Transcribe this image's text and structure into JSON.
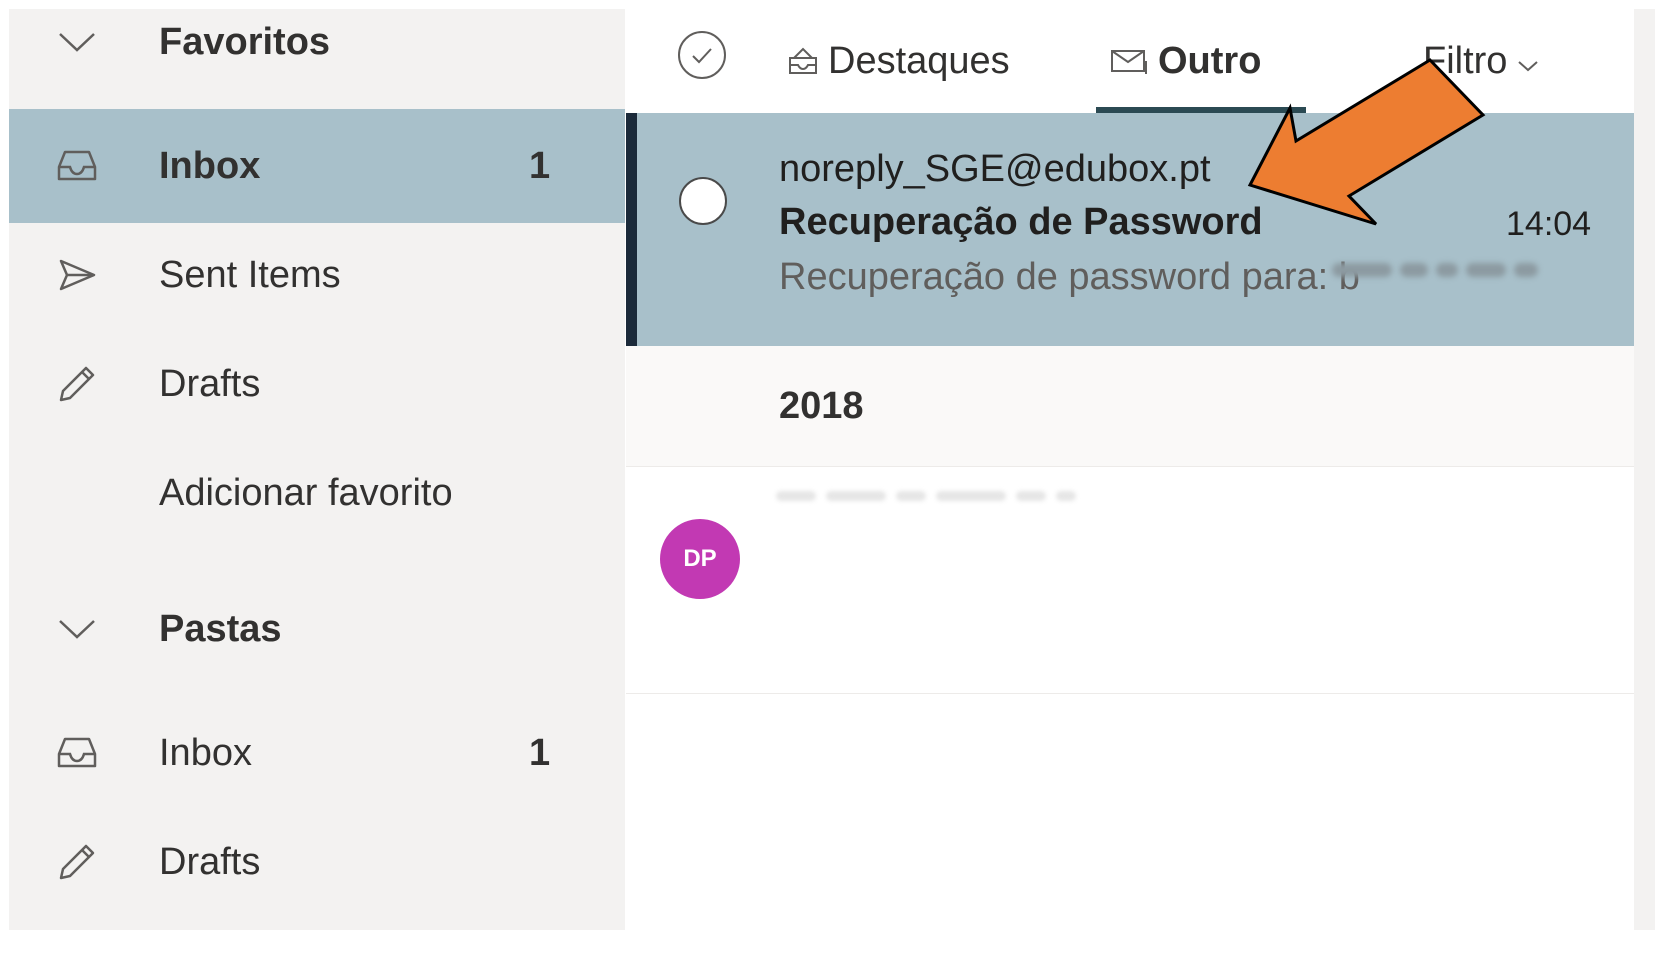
{
  "sidebar": {
    "favorites_header": {
      "label": "Favoritos",
      "icon": "chevron-down-icon"
    },
    "favorites": [
      {
        "label": "Inbox",
        "count": "1",
        "icon": "inbox-icon",
        "selected": true
      },
      {
        "label": "Sent Items",
        "count": "",
        "icon": "send-icon",
        "selected": false
      },
      {
        "label": "Drafts",
        "count": "",
        "icon": "pencil-icon",
        "selected": false
      }
    ],
    "add_favorite_label": "Adicionar favorito",
    "folders_header": {
      "label": "Pastas",
      "icon": "chevron-down-icon"
    },
    "folders": [
      {
        "label": "Inbox",
        "count": "1",
        "icon": "inbox-icon"
      },
      {
        "label": "Drafts",
        "count": "",
        "icon": "pencil-icon"
      }
    ]
  },
  "tabs": {
    "select_all_icon": "check-circle-icon",
    "items": [
      {
        "label": "Destaques",
        "icon": "focused-inbox-icon",
        "active": false
      },
      {
        "label": "Outro",
        "icon": "other-mail-icon",
        "active": true
      }
    ],
    "filter_label": "Filtro",
    "filter_icon": "chevron-down-icon"
  },
  "messages": [
    {
      "sender": "noreply_SGE@edubox.pt",
      "subject": "Recuperação de Password",
      "time": "14:04",
      "preview": "Recuperação de password para: b",
      "selected": true
    }
  ],
  "group_header": "2018",
  "second_message": {
    "avatar_initials": "DP",
    "avatar_color": "#c239b3"
  },
  "colors": {
    "selected_background": "#a8c0ca",
    "selected_accent": "#1b2a3a",
    "annotation_arrow": "#ed7d31",
    "sidebar_background": "#f3f2f1"
  },
  "annotation": {
    "type": "arrow",
    "icon": "arrow-pointer-icon",
    "points_to": "message-sender"
  }
}
